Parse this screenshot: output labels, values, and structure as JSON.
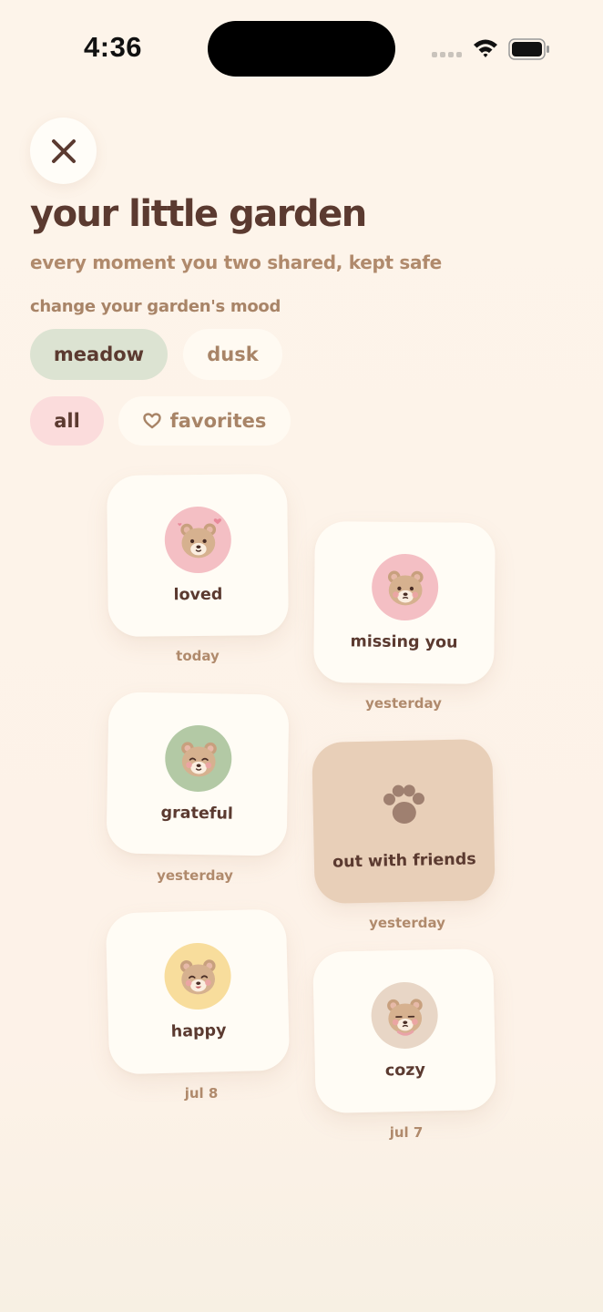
{
  "status_bar": {
    "time": "4:36"
  },
  "header": {
    "title": "your little garden",
    "subtitle": "every moment you two shared, kept safe"
  },
  "mood": {
    "label": "change your garden's mood",
    "options": [
      "meadow",
      "dusk"
    ],
    "selected": "meadow"
  },
  "filters": {
    "options": [
      "all",
      "favorites"
    ],
    "selected": "all"
  },
  "colors": {
    "accent_text": "#5b3a30",
    "muted_text": "#b08a6c",
    "pink": "#f4bfc4",
    "green": "#b3c9a5",
    "yellow": "#f8dd9c",
    "beige": "#e8d6c6",
    "paw_card": "#e8cfb8"
  },
  "moments": [
    {
      "label": "loved",
      "date": "today",
      "icon": "bear-hearts-icon",
      "bg": "pink"
    },
    {
      "label": "missing you",
      "date": "yesterday",
      "icon": "bear-blush-icon",
      "bg": "pink"
    },
    {
      "label": "grateful",
      "date": "yesterday",
      "icon": "bear-smile-icon",
      "bg": "green"
    },
    {
      "label": "out with friends",
      "date": "yesterday",
      "icon": "paw-icon",
      "bg": "paw_card"
    },
    {
      "label": "happy",
      "date": "jul 8",
      "icon": "bear-happy-icon",
      "bg": "yellow"
    },
    {
      "label": "cozy",
      "date": "jul 7",
      "icon": "bear-sleepy-icon",
      "bg": "beige"
    }
  ]
}
